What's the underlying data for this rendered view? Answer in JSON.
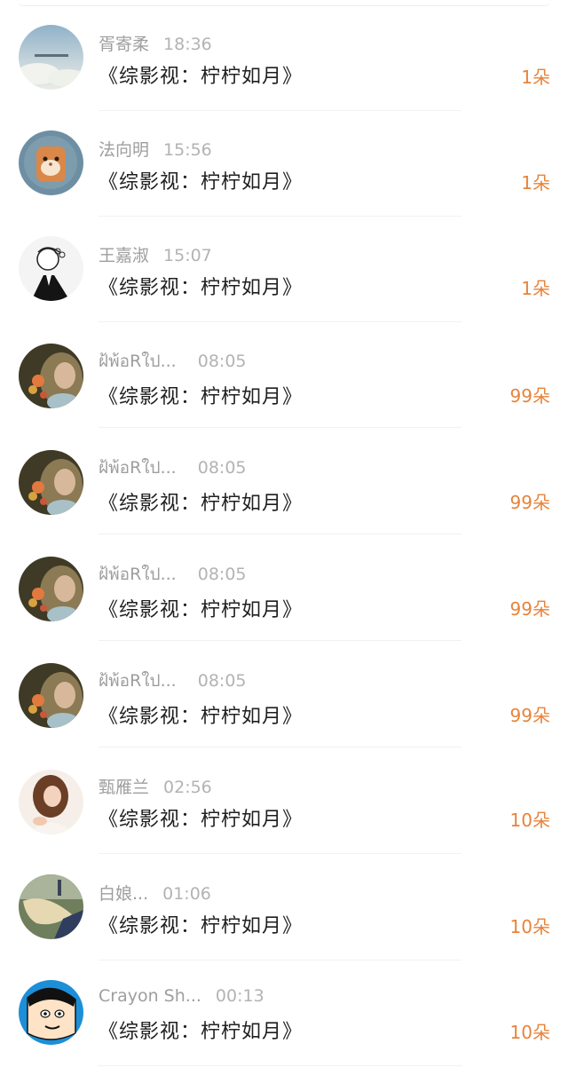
{
  "items": [
    {
      "name": "胥寄柔",
      "time": "18:36",
      "title": "《综影视：柠柠如月》",
      "count": "1朵",
      "avatar": "sky-avatar"
    },
    {
      "name": "法向明",
      "time": "15:56",
      "title": "《综影视：柠柠如月》",
      "count": "1朵",
      "avatar": "hamster-avatar"
    },
    {
      "name": "王嘉淑",
      "time": "15:07",
      "title": "《综影视：柠柠如月》",
      "count": "1朵",
      "avatar": "sketch-girl-avatar"
    },
    {
      "name": "ฝ้พ้อRใป...",
      "time": "08:05",
      "title": "《综影视：柠柠如月》",
      "count": "99朵",
      "avatar": "girl-flowers-avatar"
    },
    {
      "name": "ฝ้พ้อRใป...",
      "time": "08:05",
      "title": "《综影视：柠柠如月》",
      "count": "99朵",
      "avatar": "girl-flowers-avatar"
    },
    {
      "name": "ฝ้พ้อRใป...",
      "time": "08:05",
      "title": "《综影视：柠柠如月》",
      "count": "99朵",
      "avatar": "girl-flowers-avatar"
    },
    {
      "name": "ฝ้พ้อRใป...",
      "time": "08:05",
      "title": "《综影视：柠柠如月》",
      "count": "99朵",
      "avatar": "girl-flowers-avatar"
    },
    {
      "name": "甄雁兰",
      "time": "02:56",
      "title": "《综影视：柠柠如月》",
      "count": "10朵",
      "avatar": "girl-photo-avatar"
    },
    {
      "name": "白娘...",
      "time": "01:06",
      "title": "《综影视：柠柠如月》",
      "count": "10朵",
      "avatar": "blonde-hair-avatar"
    },
    {
      "name": "Crayon Sh...",
      "time": "00:13",
      "title": "《综影视：柠柠如月》",
      "count": "10朵",
      "avatar": "cartoon-boy-avatar"
    }
  ]
}
